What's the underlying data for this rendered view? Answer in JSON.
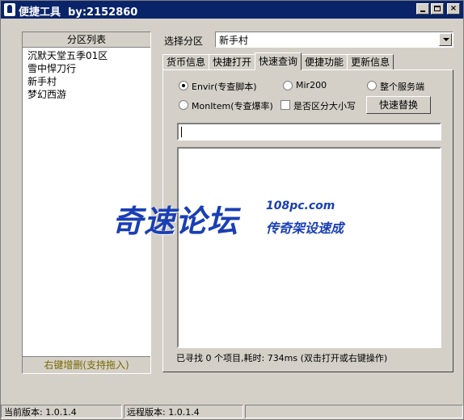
{
  "window": {
    "title": "便捷工具  by:2152860",
    "minimize": "",
    "maximize": "",
    "close": "×"
  },
  "zone_list": {
    "header": "分区列表",
    "items": [
      "沉默天堂五季01区",
      "雪中悍刀行",
      "新手村",
      "梦幻西游"
    ],
    "footer": "右键增删(支持拖入)"
  },
  "zone_select": {
    "label": "选择分区",
    "value": "新手村"
  },
  "tabs": [
    "货币信息",
    "快捷打开",
    "快速查询",
    "便捷功能",
    "更新信息"
  ],
  "active_tab": 2,
  "query": {
    "options": {
      "envir": "Envir(专查脚本)",
      "mir200": "Mir200",
      "all_server": "整个服务端",
      "monitem": "MonItem(专查爆率)",
      "case_sensitive": "是否区分大小写"
    },
    "replace_button": "快速替换",
    "search_value": "",
    "status": "已寻找 0 个项目,耗时: 734ms (双击打开或右键操作)"
  },
  "watermark": {
    "main": "奇速论坛",
    "site": "108pc.com",
    "sub": "传奇架设速成"
  },
  "statusbar": {
    "local_version": "当前版本: 1.0.1.4",
    "remote_version": "远程版本: 1.0.1.4"
  },
  "colors": {
    "titlebar": "#0a246a",
    "watermark": "#1a3fb5",
    "footer_text": "#7a6a00"
  }
}
